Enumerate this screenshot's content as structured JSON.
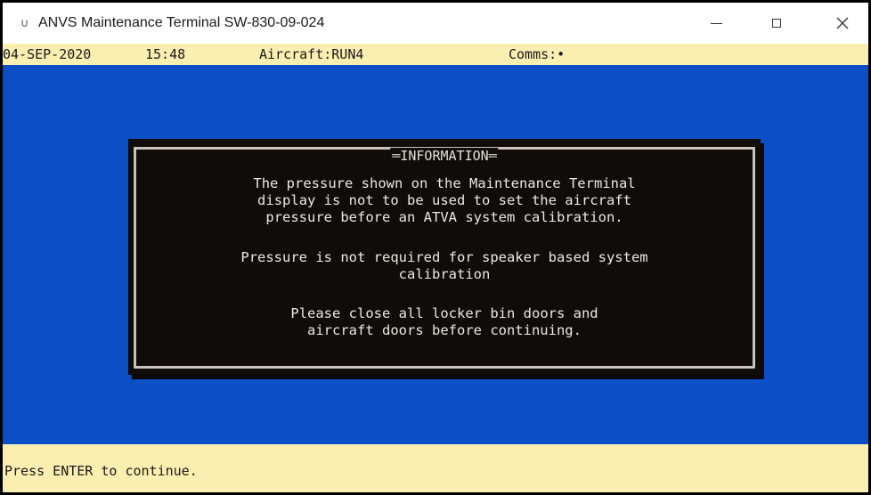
{
  "window": {
    "icon": "terminal-app-icon",
    "title": "ANVS Maintenance Terminal SW-830-09-024"
  },
  "status": {
    "date": "04-SEP-2020",
    "time": "15:48",
    "aircraft": "Aircraft:RUN4",
    "comms": "Comms:•"
  },
  "dialog": {
    "title": "INFORMATION",
    "paragraph1": [
      "The pressure shown on the Maintenance Terminal",
      "display is not to be used to set the aircraft",
      "pressure before an ATVA system calibration."
    ],
    "paragraph2": [
      "Pressure is not required for speaker based system",
      "calibration"
    ],
    "paragraph3": [
      "Please close all locker bin doors and",
      "aircraft doors before continuing."
    ]
  },
  "footer": {
    "prompt": "Press ENTER to continue."
  },
  "colors": {
    "terminal_blue": "#0b4fc6",
    "status_bar": "#fbeeb1",
    "dialog_bg": "#0f0c0a"
  }
}
